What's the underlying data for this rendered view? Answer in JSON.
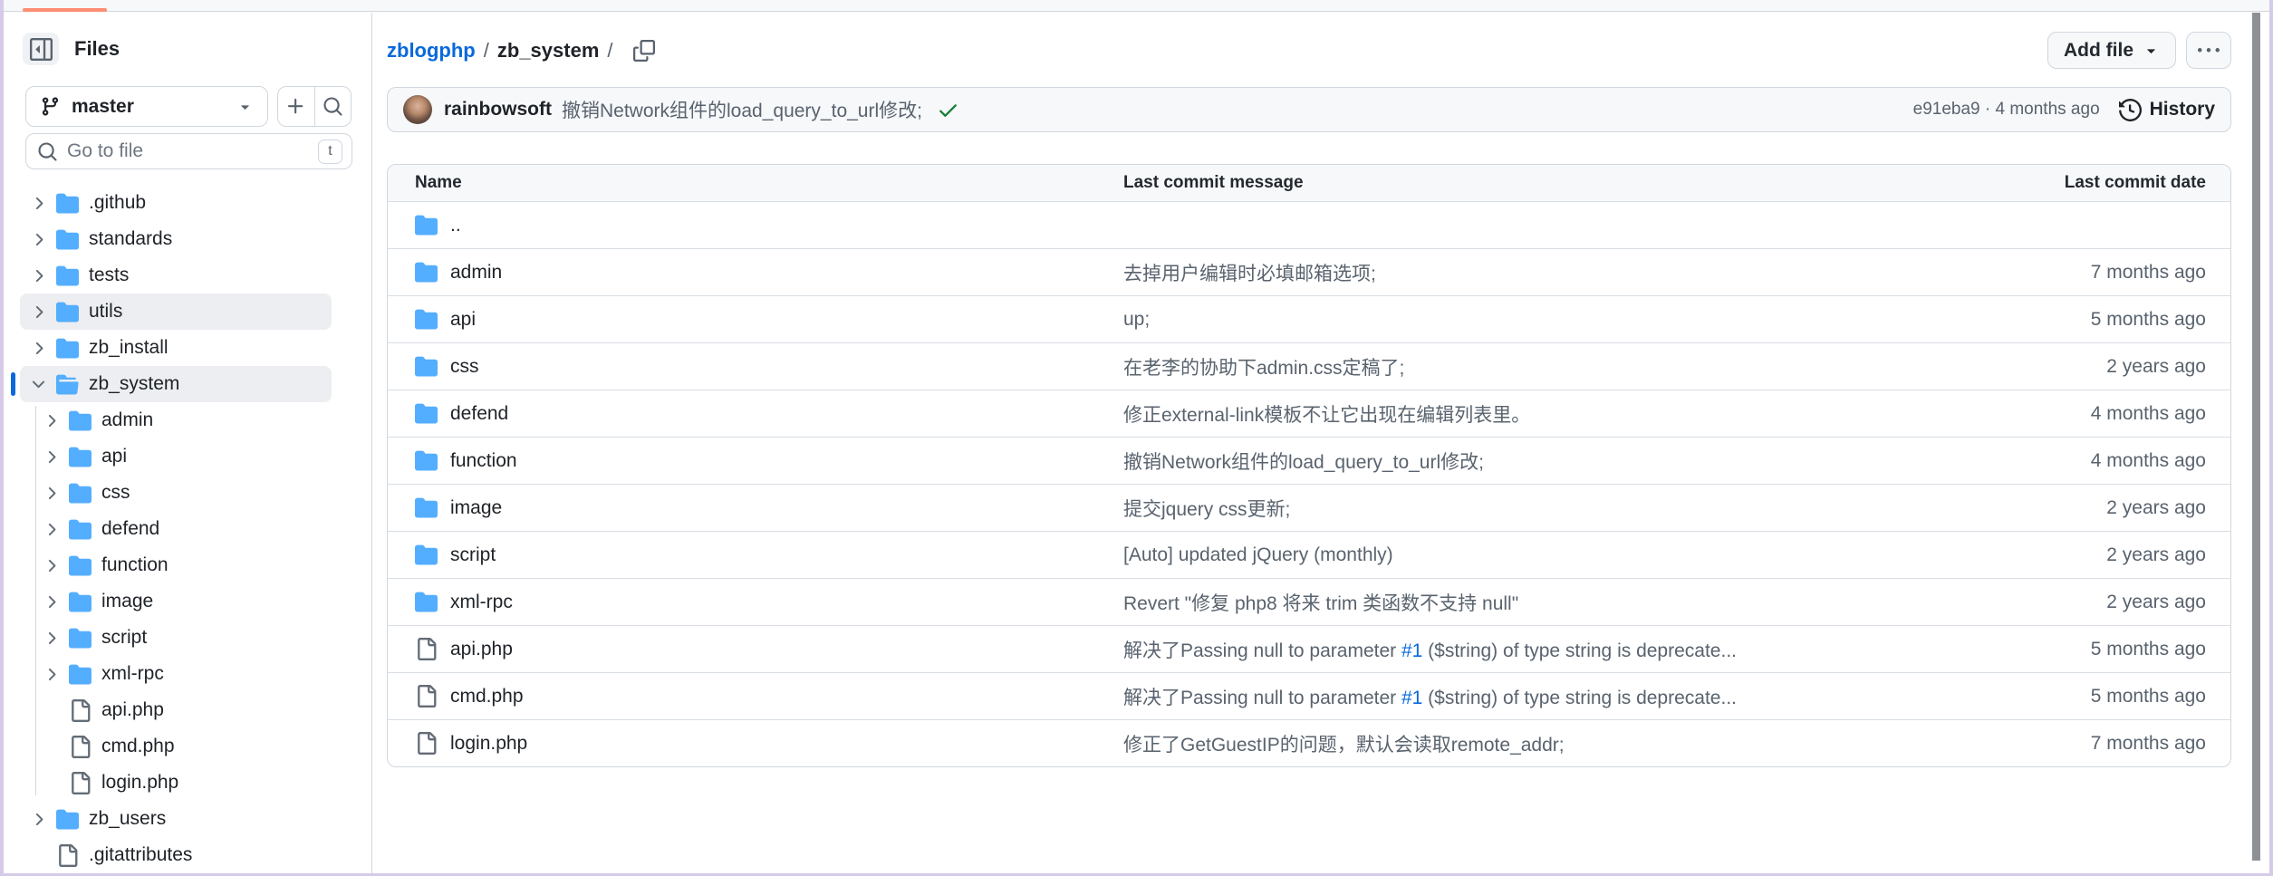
{
  "colors": {
    "accent_blue": "#0969da",
    "folder_blue": "#54aeff",
    "check_green": "#1a7f37",
    "loader_orange": "#fd8c73",
    "border": "#d0d7de",
    "muted_text": "#59636e"
  },
  "sidebar": {
    "title": "Files",
    "branch_label": "master",
    "search_placeholder": "Go to file",
    "search_kbd": "t",
    "icons": [
      "panel-collapse-icon",
      "git-branch-icon",
      "caret-down-icon",
      "plus-icon",
      "search-icon"
    ],
    "tree": [
      {
        "name": ".github",
        "type": "folder",
        "level": 0
      },
      {
        "name": "standards",
        "type": "folder",
        "level": 0
      },
      {
        "name": "tests",
        "type": "folder",
        "level": 0
      },
      {
        "name": "utils",
        "type": "folder",
        "level": 0,
        "hovered": true
      },
      {
        "name": "zb_install",
        "type": "folder",
        "level": 0
      },
      {
        "name": "zb_system",
        "type": "folder-open",
        "level": 0,
        "selected": true,
        "expanded": true
      },
      {
        "name": "admin",
        "type": "folder",
        "level": 1
      },
      {
        "name": "api",
        "type": "folder",
        "level": 1
      },
      {
        "name": "css",
        "type": "folder",
        "level": 1
      },
      {
        "name": "defend",
        "type": "folder",
        "level": 1
      },
      {
        "name": "function",
        "type": "folder",
        "level": 1
      },
      {
        "name": "image",
        "type": "folder",
        "level": 1
      },
      {
        "name": "script",
        "type": "folder",
        "level": 1
      },
      {
        "name": "xml-rpc",
        "type": "folder",
        "level": 1
      },
      {
        "name": "api.php",
        "type": "file",
        "level": 1
      },
      {
        "name": "cmd.php",
        "type": "file",
        "level": 1
      },
      {
        "name": "login.php",
        "type": "file",
        "level": 1
      },
      {
        "name": "zb_users",
        "type": "folder",
        "level": 0
      },
      {
        "name": ".gitattributes",
        "type": "file",
        "level": 0
      }
    ]
  },
  "header": {
    "breadcrumb": {
      "repo": "zblogphp",
      "sep1": "/",
      "dir": "zb_system",
      "sep2": "/"
    },
    "add_file_label": "Add file",
    "more_button": "kebab-icon"
  },
  "commit_bar": {
    "author": "rainbowsoft",
    "message": "撤销Network组件的load_query_to_url修改;",
    "sha": "e91eba9",
    "dot": "·",
    "time": "4 months ago",
    "history_label": "History"
  },
  "table": {
    "headers": {
      "name": "Name",
      "message": "Last commit message",
      "date": "Last commit date"
    },
    "rows": [
      {
        "name": "..",
        "type": "folder",
        "message": "",
        "date": ""
      },
      {
        "name": "admin",
        "type": "folder",
        "message": "去掉用户编辑时必填邮箱选项;",
        "date": "7 months ago"
      },
      {
        "name": "api",
        "type": "folder",
        "message": "up;",
        "date": "5 months ago"
      },
      {
        "name": "css",
        "type": "folder",
        "message": "在老李的协助下admin.css定稿了;",
        "date": "2 years ago"
      },
      {
        "name": "defend",
        "type": "folder",
        "message": "修正external-link模板不让它出现在编辑列表里。",
        "date": "4 months ago"
      },
      {
        "name": "function",
        "type": "folder",
        "message": "撤销Network组件的load_query_to_url修改;",
        "date": "4 months ago"
      },
      {
        "name": "image",
        "type": "folder",
        "message": "提交jquery css更新;",
        "date": "2 years ago"
      },
      {
        "name": "script",
        "type": "folder",
        "message": "[Auto] updated jQuery (monthly)",
        "date": "2 years ago"
      },
      {
        "name": "xml-rpc",
        "type": "folder",
        "message": "Revert \"修复 php8 将来 trim 类函数不支持 null\"",
        "date": "2 years ago"
      },
      {
        "name": "api.php",
        "type": "file",
        "message_pre": "解决了Passing null to parameter ",
        "message_link": "#1",
        "message_post": " ($string) of type string is deprecate...",
        "date": "5 months ago"
      },
      {
        "name": "cmd.php",
        "type": "file",
        "message_pre": "解决了Passing null to parameter ",
        "message_link": "#1",
        "message_post": " ($string) of type string is deprecate...",
        "date": "5 months ago"
      },
      {
        "name": "login.php",
        "type": "file",
        "message": "修正了GetGuestIP的问题，默认会读取remote_addr;",
        "date": "7 months ago"
      }
    ]
  }
}
